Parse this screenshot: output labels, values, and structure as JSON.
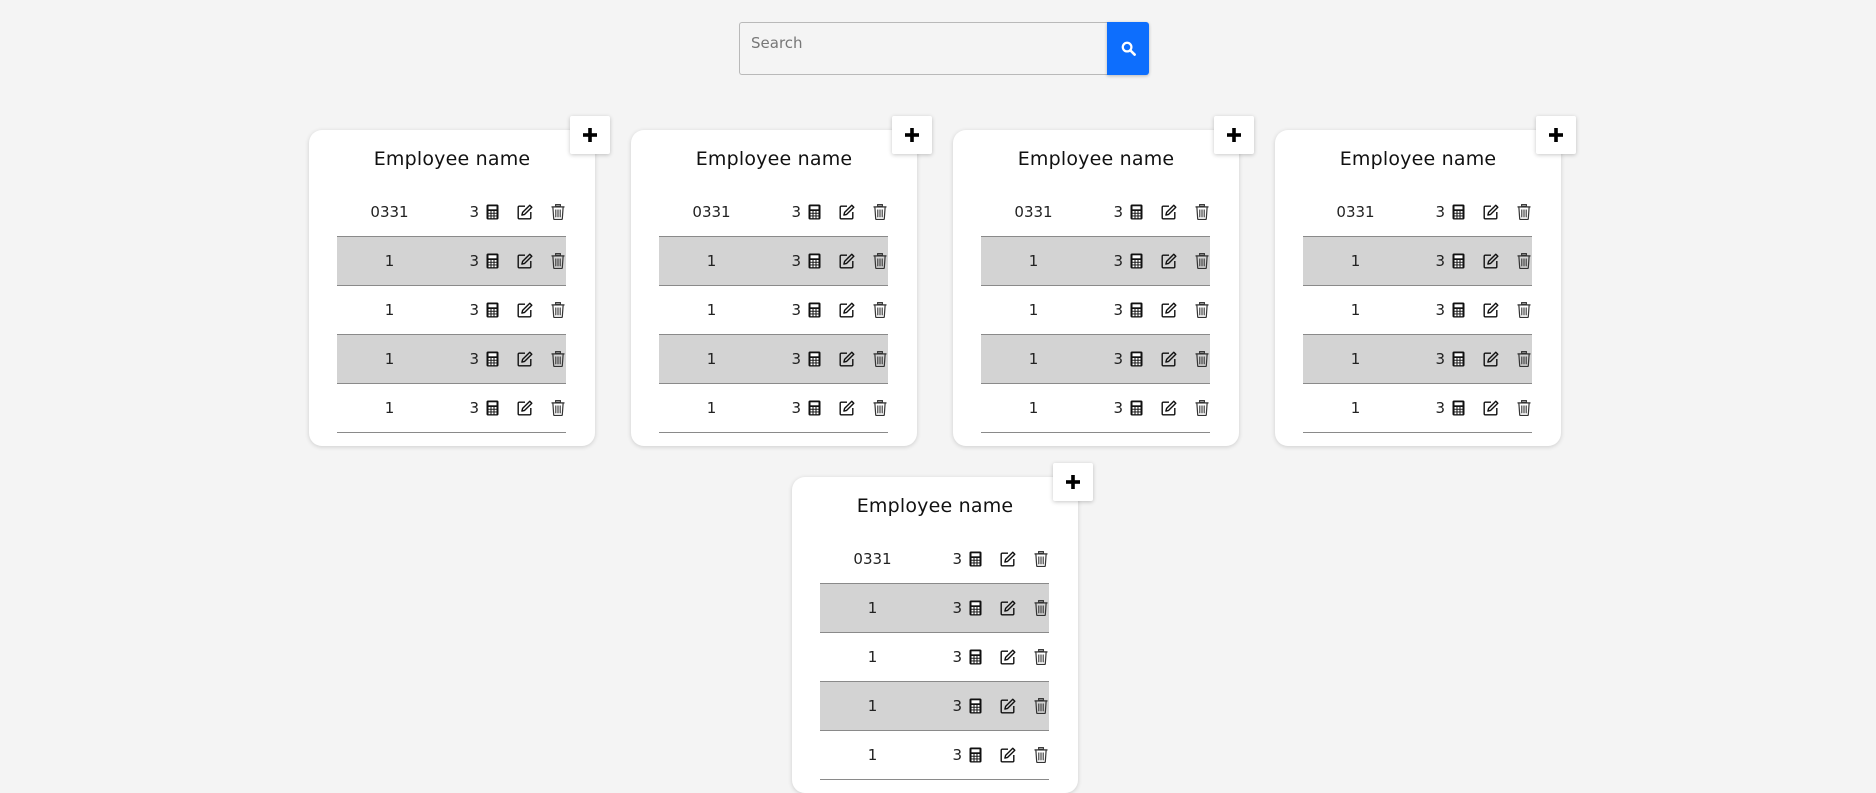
{
  "search": {
    "placeholder": "Search"
  },
  "icons": {
    "search": "search-icon",
    "add": "plus-icon",
    "calculator": "calculator-icon",
    "edit": "edit-icon",
    "delete": "trash-icon"
  },
  "colors": {
    "accent": "#0d6efd",
    "background": "#f4f4f4",
    "row_shaded": "#d3d3d3"
  },
  "cards": [
    {
      "title": "Employee name",
      "rows": [
        {
          "id": "0331",
          "qty": "3"
        },
        {
          "id": "1",
          "qty": "3"
        },
        {
          "id": "1",
          "qty": "3"
        },
        {
          "id": "1",
          "qty": "3"
        },
        {
          "id": "1",
          "qty": "3"
        }
      ]
    },
    {
      "title": "Employee name",
      "rows": [
        {
          "id": "0331",
          "qty": "3"
        },
        {
          "id": "1",
          "qty": "3"
        },
        {
          "id": "1",
          "qty": "3"
        },
        {
          "id": "1",
          "qty": "3"
        },
        {
          "id": "1",
          "qty": "3"
        }
      ]
    },
    {
      "title": "Employee name",
      "rows": [
        {
          "id": "0331",
          "qty": "3"
        },
        {
          "id": "1",
          "qty": "3"
        },
        {
          "id": "1",
          "qty": "3"
        },
        {
          "id": "1",
          "qty": "3"
        },
        {
          "id": "1",
          "qty": "3"
        }
      ]
    },
    {
      "title": "Employee name",
      "rows": [
        {
          "id": "0331",
          "qty": "3"
        },
        {
          "id": "1",
          "qty": "3"
        },
        {
          "id": "1",
          "qty": "3"
        },
        {
          "id": "1",
          "qty": "3"
        },
        {
          "id": "1",
          "qty": "3"
        }
      ]
    },
    {
      "title": "Employee name",
      "rows": [
        {
          "id": "0331",
          "qty": "3"
        },
        {
          "id": "1",
          "qty": "3"
        },
        {
          "id": "1",
          "qty": "3"
        },
        {
          "id": "1",
          "qty": "3"
        },
        {
          "id": "1",
          "qty": "3"
        }
      ]
    }
  ]
}
